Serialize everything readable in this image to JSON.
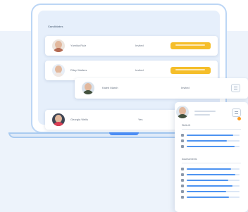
{
  "app": {
    "colors": {
      "accent": "#4d93f1",
      "primary_action": "#f5be2a",
      "notification": "#ff9d1f",
      "background": "#edf3fb"
    }
  },
  "main": {
    "section_title": "Candidates",
    "candidates": [
      {
        "name": "Yumika Ruiz",
        "status": "Invited",
        "action_button_text": "",
        "avatar_icon": "woman-avatar",
        "avatar_shirt_color": "#b46a52"
      },
      {
        "name": "Riley Walters",
        "status": "Invited",
        "action_button_text": "",
        "avatar_icon": "woman-avatar",
        "avatar_shirt_color": "#f0e8e4"
      },
      {
        "name": "Kaleb Marsh",
        "status": "Invited",
        "document_icon": "document-icon",
        "avatar_icon": "man-avatar",
        "avatar_shirt_color": "#43513e"
      },
      {
        "name": "Georgia Wells",
        "status": "Yes",
        "avatar_icon": "woman-avatar",
        "avatar_shirt_color": "#db3d54"
      }
    ]
  },
  "detail_panel": {
    "avatar_icon": "man-avatar",
    "document_icon": "document-icon",
    "notification_icon": "orange-dot",
    "groups": [
      {
        "title": "Skills fit",
        "items": [
          {
            "icon": "chart-icon",
            "score": 0.88
          },
          {
            "icon": "chart-icon",
            "score": 0.76
          },
          {
            "icon": "chart-icon",
            "score": 0.9
          }
        ]
      },
      {
        "title": "Assessments",
        "items": [
          {
            "icon": "check-icon",
            "score": 0.84
          },
          {
            "icon": "check-icon",
            "score": 0.92
          },
          {
            "icon": "check-icon",
            "score": 0.78
          },
          {
            "icon": "check-icon",
            "score": 0.86
          },
          {
            "icon": "check-icon",
            "score": 0.74
          },
          {
            "icon": "check-icon",
            "score": 0.8
          }
        ]
      }
    ]
  }
}
